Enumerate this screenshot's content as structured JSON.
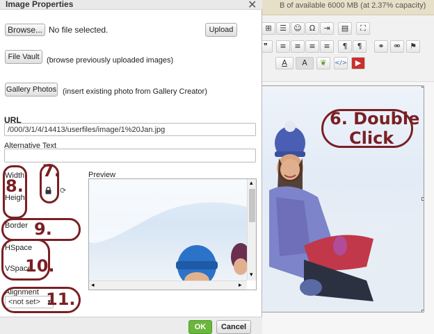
{
  "background": {
    "capacity_text": "B of available 6000 MB (at 2.37% capacity)",
    "toolbar_row1": [
      "⊞",
      "☰",
      "☺",
      "Ω",
      "⇥",
      "▤",
      "⛶"
    ],
    "toolbar_row2": [
      "❞",
      "≡",
      "≡",
      "≡",
      "≡",
      "¶",
      "¶",
      "⚭",
      "⚮",
      "⚑"
    ],
    "toolbar_row3": [
      "A",
      "A",
      "❦",
      "</>",
      "▶"
    ]
  },
  "dialog": {
    "title": "Image Properties",
    "browse": {
      "button": "Browse...",
      "status": "No file selected."
    },
    "upload_label": "Upload",
    "file_vault": {
      "button": "File Vault",
      "hint": "(browse previously uploaded images)"
    },
    "gallery": {
      "button": "Gallery Photos",
      "hint": "(insert existing photo from Gallery Creator)"
    },
    "url": {
      "label": "URL",
      "value": "/000/3/1/4/14413/userfiles/image/1%20Jan.jpg"
    },
    "alt": {
      "label": "Alternative Text",
      "value": ""
    },
    "width_label": "Width",
    "height_label": "Height",
    "border_label": "Border",
    "hspace_label": "HSpace",
    "vspace_label": "VSpace",
    "alignment": {
      "label": "Alignment",
      "selected": "<not set>"
    },
    "preview_label": "Preview",
    "ok_label": "OK",
    "cancel_label": "Cancel"
  },
  "annotations": {
    "step6_line1": "6. Double",
    "step6_line2": "Click",
    "step7": "7.",
    "step8": "8.",
    "step9": "9.",
    "step10": "10.",
    "step11": "11."
  },
  "colors": {
    "annotation": "#7a1f24",
    "ok_button": "#6bb63c",
    "capacity_bar": "#e7dfc8"
  },
  "icons": {
    "close": "close-icon",
    "lock": "lock-icon",
    "reset_size": "reset-size-icon"
  }
}
